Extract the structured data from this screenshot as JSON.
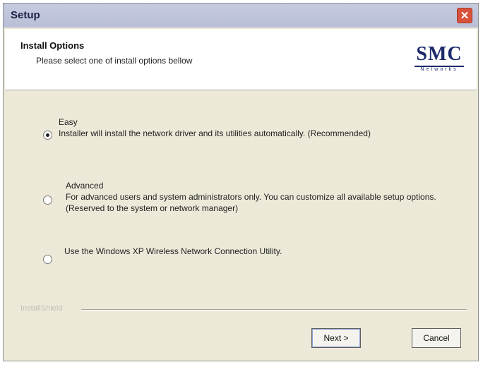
{
  "window": {
    "title": "Setup",
    "close_glyph": "✕",
    "close_icon": "close-icon"
  },
  "header": {
    "title": "Install Options",
    "subtitle": "Please select one of install options bellow",
    "logo": {
      "main": "SMC",
      "sub": "Networks"
    }
  },
  "options": [
    {
      "label": "Easy",
      "description": "Installer will install the network driver and its utilities automatically. (Recommended)",
      "selected": true
    },
    {
      "label": "Advanced",
      "description": "For advanced users and system administrators only.  You can customize all available setup options. (Reserved to the system or network manager)",
      "selected": false
    },
    {
      "label": "",
      "description": "Use the Windows XP Wireless Network Connection Utility.",
      "selected": false
    }
  ],
  "footer": {
    "brand": "InstallShield",
    "next_label": "Next >",
    "cancel_label": "Cancel"
  }
}
